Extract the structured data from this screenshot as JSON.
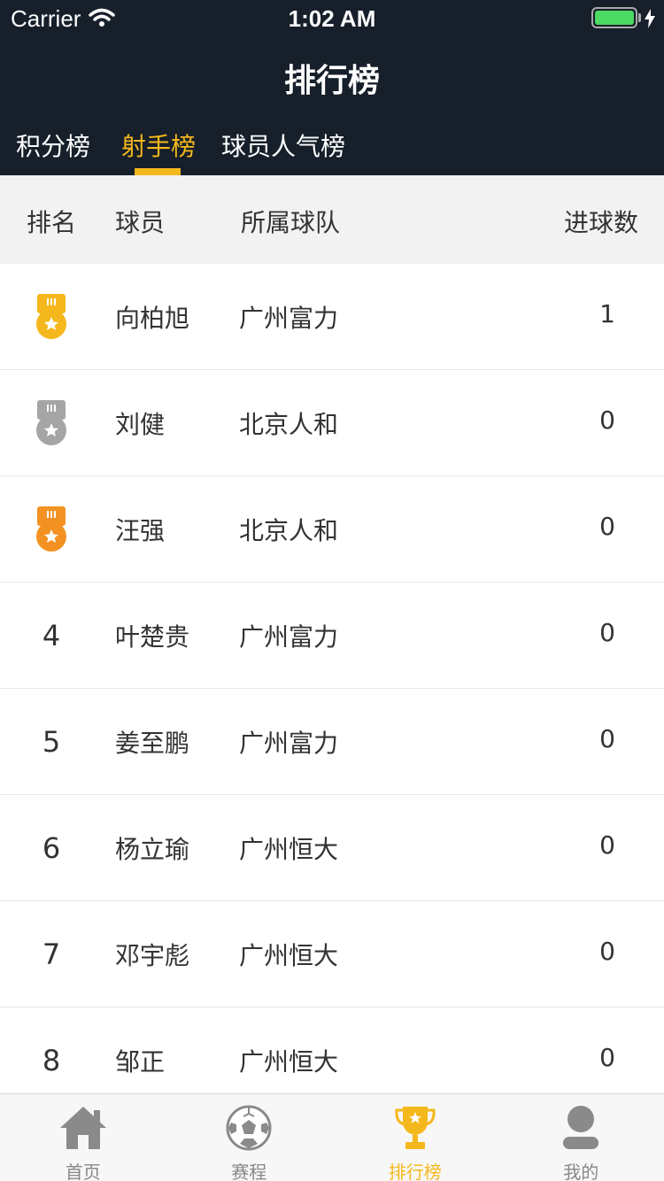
{
  "status_bar": {
    "carrier": "Carrier",
    "time": "1:02 AM",
    "battery_level": 1.0
  },
  "nav": {
    "title": "排行榜"
  },
  "tabs": [
    {
      "label": "积分榜",
      "active": false
    },
    {
      "label": "射手榜",
      "active": true
    },
    {
      "label": "球员人气榜",
      "active": false
    }
  ],
  "table_header": {
    "rank": "排名",
    "player": "球员",
    "team": "所属球队",
    "goals": "进球数"
  },
  "rows": [
    {
      "rank": "",
      "medal": "gold",
      "player": "向柏旭",
      "team": "广州富力",
      "goals": "1"
    },
    {
      "rank": "",
      "medal": "silver",
      "player": "刘健",
      "team": "北京人和",
      "goals": "0"
    },
    {
      "rank": "",
      "medal": "bronze",
      "player": "汪强",
      "team": "北京人和",
      "goals": "0"
    },
    {
      "rank": "4",
      "medal": "",
      "player": "叶楚贵",
      "team": "广州富力",
      "goals": "0"
    },
    {
      "rank": "5",
      "medal": "",
      "player": "姜至鹏",
      "team": "广州富力",
      "goals": "0"
    },
    {
      "rank": "6",
      "medal": "",
      "player": "杨立瑜",
      "team": "广州恒大",
      "goals": "0"
    },
    {
      "rank": "7",
      "medal": "",
      "player": "邓宇彪",
      "team": "广州恒大",
      "goals": "0"
    },
    {
      "rank": "8",
      "medal": "",
      "player": "邹正",
      "team": "广州恒大",
      "goals": "0"
    }
  ],
  "tab_bar": [
    {
      "label": "首页",
      "icon": "home-icon",
      "active": false
    },
    {
      "label": "赛程",
      "icon": "soccer-ball-icon",
      "active": false
    },
    {
      "label": "排行榜",
      "icon": "trophy-icon",
      "active": true
    },
    {
      "label": "我的",
      "icon": "user-icon",
      "active": false
    }
  ],
  "colors": {
    "header_bg": "#161f2a",
    "accent": "#f5b81c",
    "medal_gold": "#f5b81c",
    "medal_silver": "#a5a5a5",
    "medal_bronze": "#f39222",
    "tab_inactive": "#888888"
  }
}
